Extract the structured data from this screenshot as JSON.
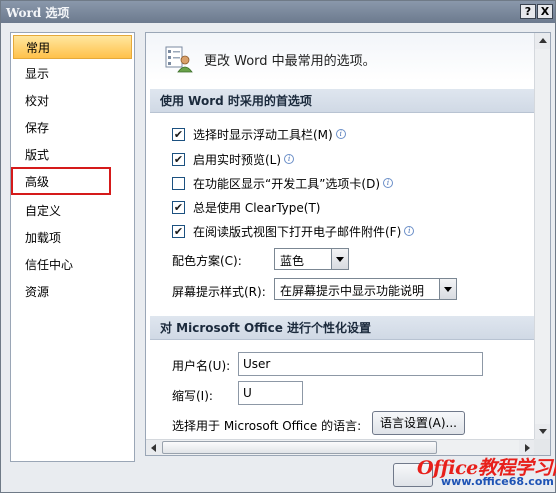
{
  "window": {
    "title": "Word 选项",
    "help_button": "?",
    "close_button": "X"
  },
  "sidebar": {
    "items": [
      {
        "label": "常用"
      },
      {
        "label": "显示"
      },
      {
        "label": "校对"
      },
      {
        "label": "保存"
      },
      {
        "label": "版式"
      },
      {
        "label": "高级"
      },
      {
        "label": "自定义"
      },
      {
        "label": "加载项"
      },
      {
        "label": "信任中心"
      },
      {
        "label": "资源"
      }
    ],
    "selected": "常用",
    "highlighted": "高级"
  },
  "main": {
    "header_text": "更改 Word 中最常用的选项。",
    "section1": {
      "title": "使用 Word 时采用的首选项",
      "options": [
        {
          "label": "选择时显示浮动工具栏(M)",
          "checked": true,
          "info": true
        },
        {
          "label": "启用实时预览(L)",
          "checked": true,
          "info": true
        },
        {
          "label": "在功能区显示“开发工具”选项卡(D)",
          "checked": false,
          "info": true
        },
        {
          "label": "总是使用 ClearType(T)",
          "checked": true,
          "info": false
        },
        {
          "label": "在阅读版式视图下打开电子邮件附件(F)",
          "checked": true,
          "info": true
        }
      ],
      "color_scheme_label": "配色方案(C):",
      "color_scheme_value": "蓝色",
      "screentip_label": "屏幕提示样式(R):",
      "screentip_value": "在屏幕提示中显示功能说明"
    },
    "section2": {
      "title": "对 Microsoft Office 进行个性化设置",
      "username_label": "用户名(U):",
      "username_value": "User",
      "initials_label": "缩写(I):",
      "initials_value": "U",
      "language_label": "选择用于 Microsoft Office 的语言:",
      "language_button": "语言设置(A)..."
    }
  },
  "watermark": {
    "line1": "Office教程学习网",
    "line2": "www.office68.com"
  },
  "colors": {
    "accent_selected": "#ffc14a",
    "highlight_border": "#d51a1a",
    "section_band": "#d6dee9"
  }
}
